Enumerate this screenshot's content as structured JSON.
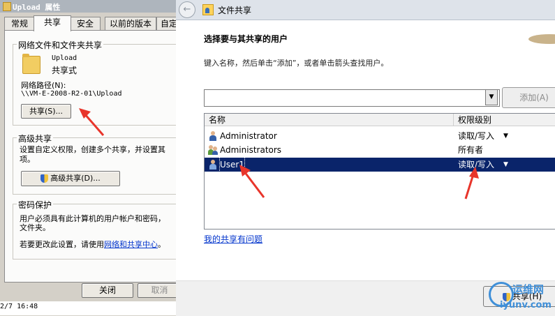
{
  "props_dialog": {
    "title": "Upload 属性",
    "tabs": [
      "常规",
      "共享",
      "安全",
      "以前的版本",
      "自定"
    ],
    "active_tab": "共享",
    "network_group": {
      "label": "网络文件和文件夹共享",
      "folder_name": "Upload",
      "folder_status": "共享式",
      "path_label": "网络路径(N):",
      "path_value": "\\\\VM-E-2008-R2-01\\Upload",
      "share_button": "共享(S)..."
    },
    "advanced_group": {
      "label": "高级共享",
      "desc_line1": "设置自定义权限，创建多个共享，并设置其",
      "desc_line2": "项。",
      "button": "高级共享(D)..."
    },
    "password_group": {
      "label": "密码保护",
      "desc_line1": "用户必须具有此计算机的用户帐户和密码，",
      "desc_line2": "文件夹。",
      "change_prefix": "若要更改此设置，请使用",
      "change_link": "网络和共享中心",
      "change_suffix": "。"
    },
    "close_button": "关闭",
    "cancel_button": "取消",
    "bottom_time": "2/7 16:48"
  },
  "wizard": {
    "title": "文件共享",
    "back_icon": "back-arrow-icon",
    "heading": "选择要与其共享的用户",
    "subheading": "键入名称，然后单击“添加”，或者单击箭头查找用户。",
    "input_value": "",
    "add_button": "添加(A)",
    "table": {
      "columns": [
        "名称",
        "权限级别"
      ],
      "rows": [
        {
          "name": "Administrator",
          "permission": "读取/写入",
          "has_dropdown": true,
          "selected": false
        },
        {
          "name": "Administrators",
          "permission": "所有者",
          "has_dropdown": false,
          "selected": false
        },
        {
          "name": "User1",
          "permission": "读取/写入",
          "has_dropdown": true,
          "selected": true
        }
      ]
    },
    "problem_link": "我的共享有问题",
    "share_button": "共享(H)"
  },
  "watermark": {
    "line1": "运维网",
    "line2": "iyunv.com"
  },
  "colors": {
    "selection": "#0a246a",
    "link": "#0033cc",
    "annotation": "#e8352b"
  }
}
